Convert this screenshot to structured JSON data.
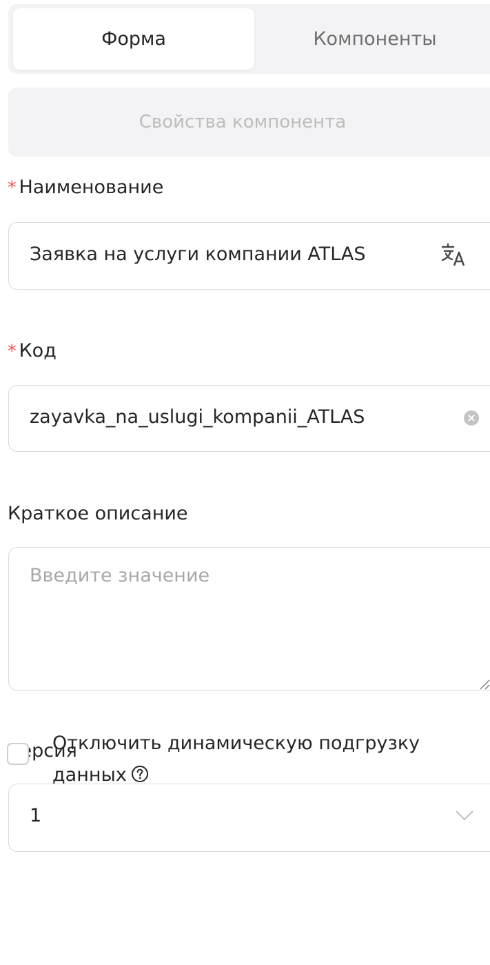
{
  "tabs": {
    "form_label": "Форма",
    "components_label": "Компоненты"
  },
  "component_properties_label": "Свойства компонента",
  "fields": {
    "name": {
      "label": "Наименование",
      "required_mark": "*",
      "value": "Заявка на услуги компании ATLAS",
      "icon": "translate-icon"
    },
    "code": {
      "label": "Код",
      "required_mark": "*",
      "value": "zayavka_na_uslugi_kompanii_ATLAS",
      "icon": "clear-icon"
    },
    "description": {
      "label": "Краткое описание",
      "placeholder": "Введите значение",
      "value": ""
    },
    "version": {
      "label": "Версия",
      "selected": "1",
      "icon": "chevron-down-icon"
    }
  },
  "dynamic_loading": {
    "checked": false,
    "label": "Отключить динамическую подгрузку данных",
    "icon": "help-icon"
  },
  "colors": {
    "required": "#ff4d4f",
    "border": "#d9d9d9",
    "segment_bg": "#f3f3f5",
    "placeholder": "#a8a8a8"
  }
}
